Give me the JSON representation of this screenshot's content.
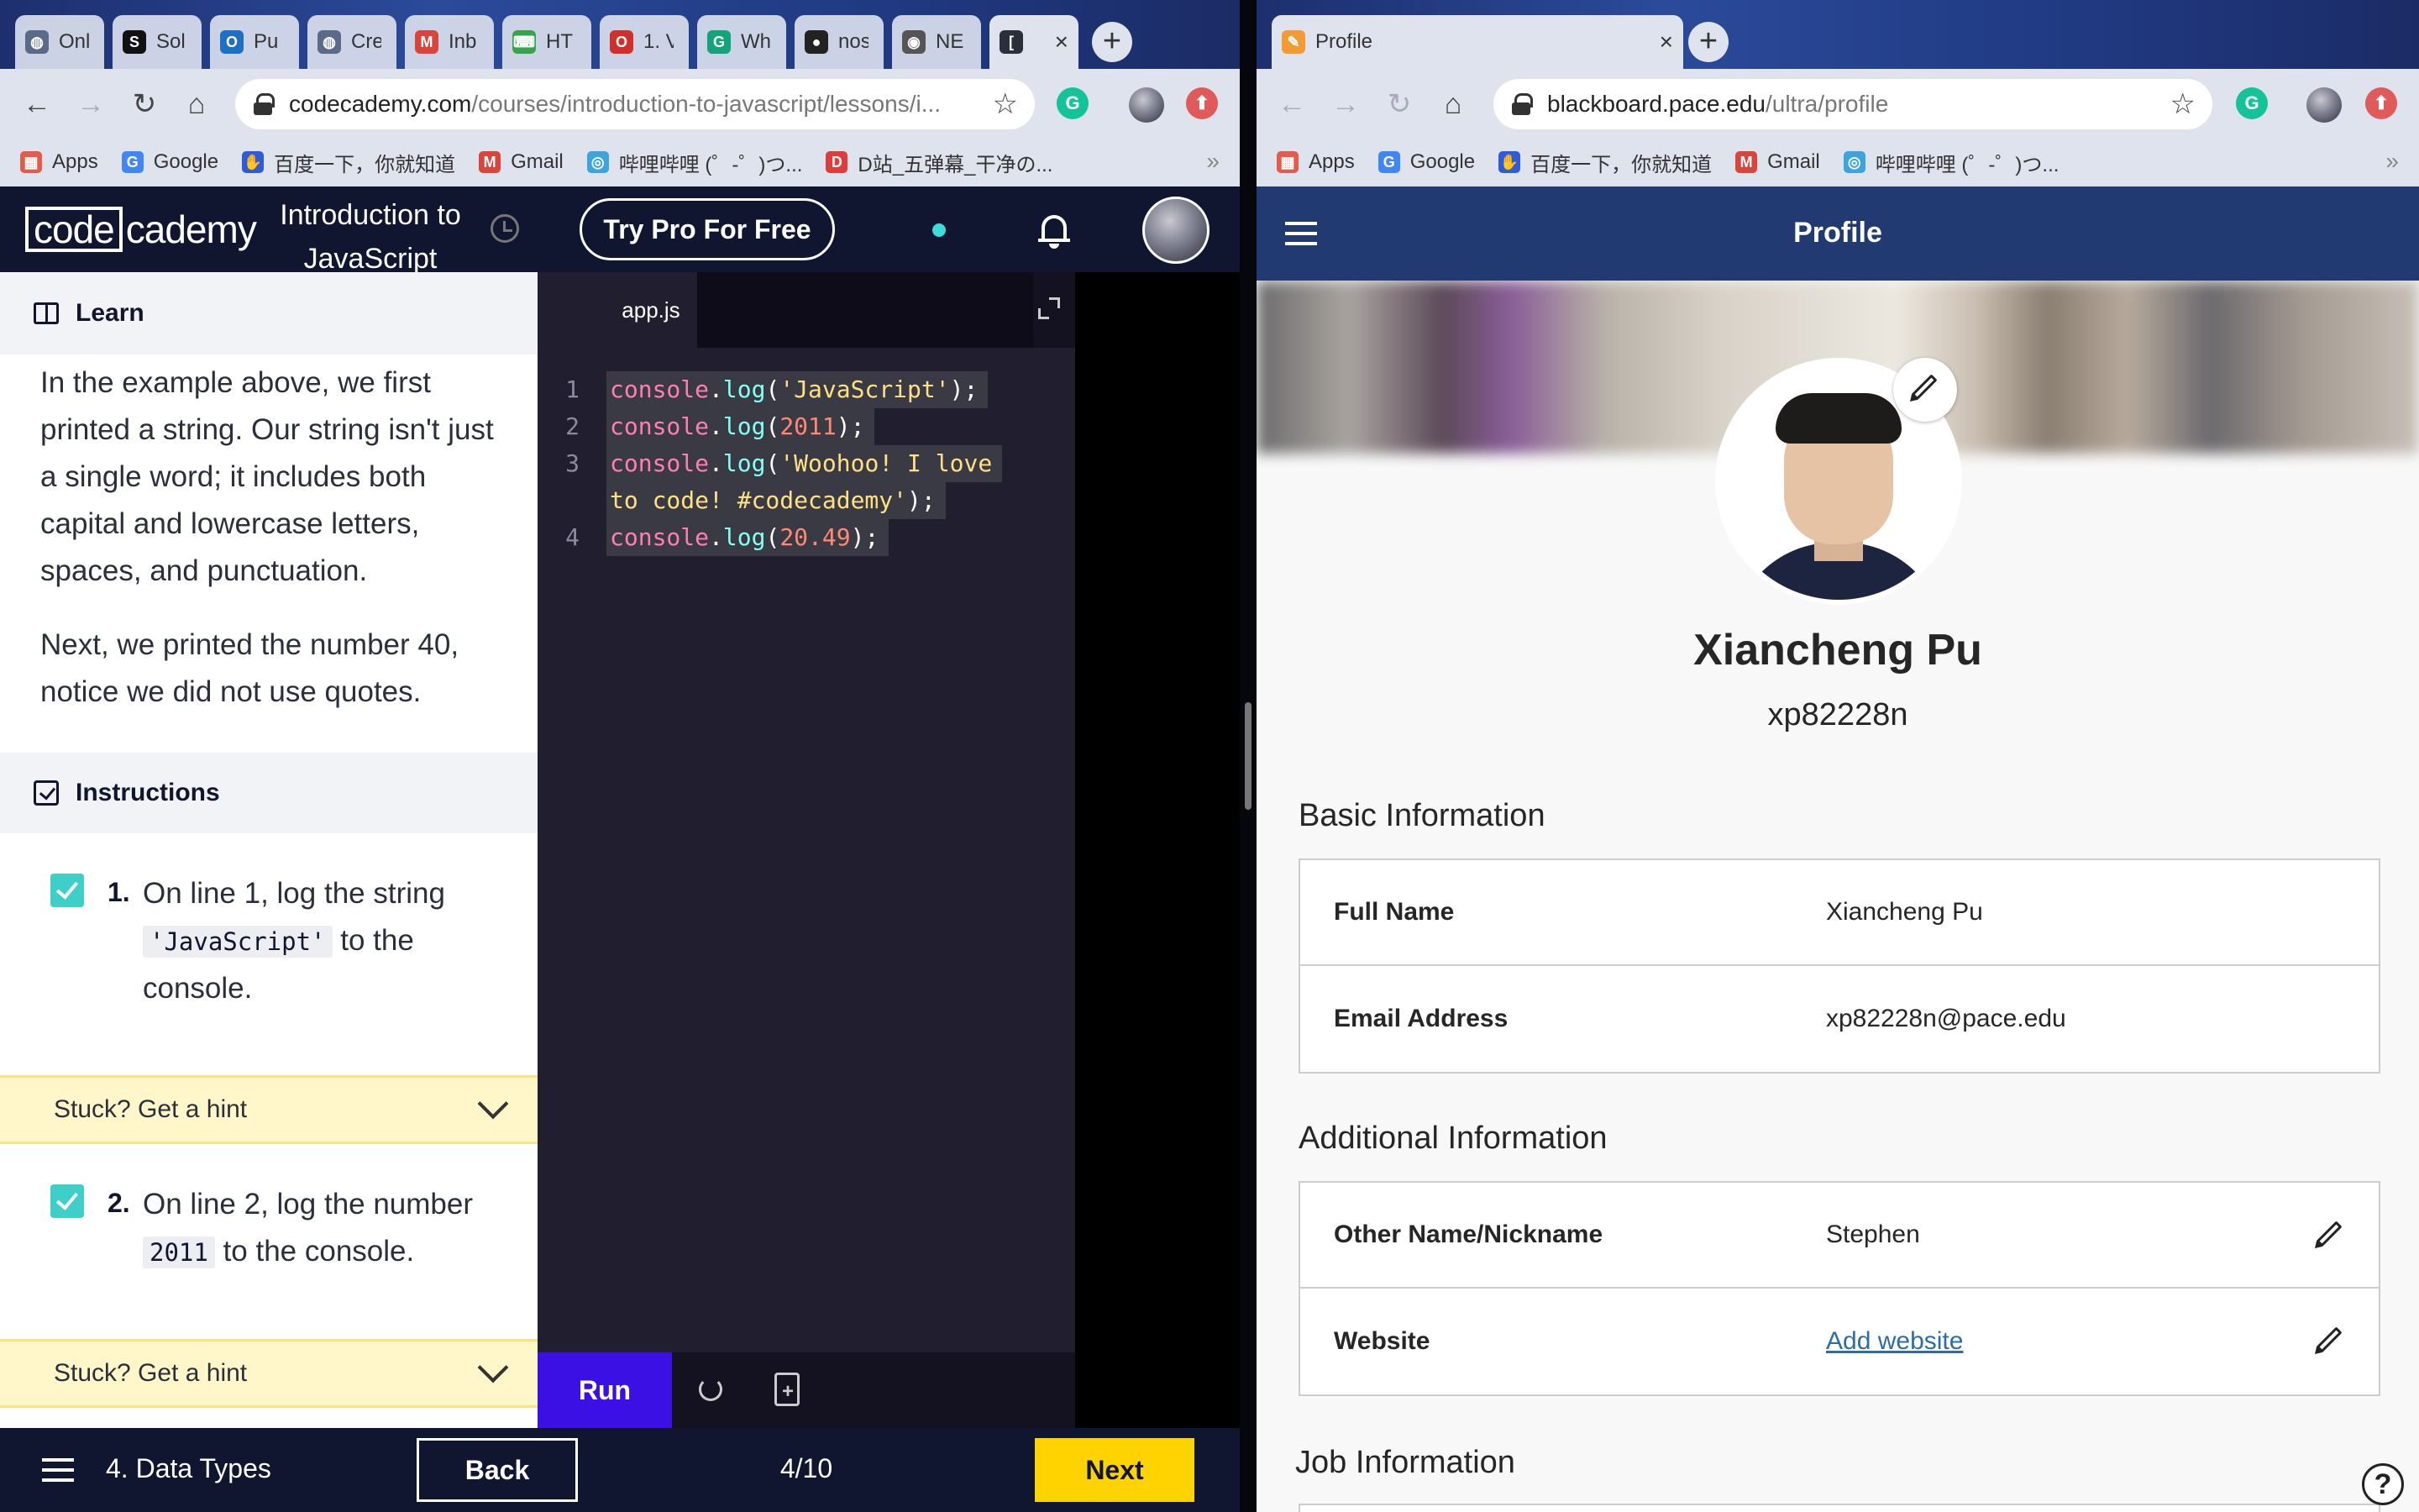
{
  "left_browser": {
    "tabs": [
      {
        "label": "Onl",
        "icon": "globe-icon",
        "color": "#5a6b8a"
      },
      {
        "label": "Sol",
        "icon": "s-logo-icon",
        "color": "#111111"
      },
      {
        "label": "Pu",
        "icon": "outlook-icon",
        "color": "#1f6fc5"
      },
      {
        "label": "Cre",
        "icon": "globe-icon",
        "color": "#5a6b8a"
      },
      {
        "label": "Inb",
        "icon": "gmail-icon",
        "color": "#d9453b"
      },
      {
        "label": "HT",
        "icon": "code-icon",
        "color": "#37a34a"
      },
      {
        "label": "1. V",
        "icon": "opera-icon",
        "color": "#d0302c"
      },
      {
        "label": "Wh",
        "icon": "grammarly-icon",
        "color": "#15a37a"
      },
      {
        "label": "nos",
        "icon": "github-icon",
        "color": "#222222"
      },
      {
        "label": "NE",
        "icon": "gamepad-icon",
        "color": "#555555"
      }
    ],
    "active_tab_icon": "codecademy-icon",
    "url_host": "codecademy.com",
    "url_path": "/courses/introduction-to-javascript/lessons/i...",
    "bookmarks": [
      "Apps",
      "Google",
      "百度一下，你就知道",
      "Gmail",
      "哔哩哔哩 (゜-゜)つ...",
      "D站_五弹幕_干净の..."
    ],
    "bookmarks_more": "»"
  },
  "codecademy": {
    "logo_box": "code",
    "logo_rest": "cademy",
    "course_title": "Introduction to JavaScript",
    "pro_button": "Try Pro For Free",
    "learn_title": "Learn",
    "learn_para1": "In the example above, we first printed a string. Our string isn't just a single word; it includes both capital and lowercase letters, spaces, and punctuation.",
    "learn_para2": "Next, we printed the number 40, notice we did not use quotes.",
    "instructions_title": "Instructions",
    "tasks": [
      {
        "num": "1.",
        "pre": "On line 1, log the string ",
        "code": "'JavaScript'",
        "post": " to the console."
      },
      {
        "num": "2.",
        "pre": "On line 2, log the number ",
        "code": "2011",
        "post": " to the console."
      }
    ],
    "hint_label": "Stuck? Get a hint",
    "editor_tab": "app.js",
    "code_lines": [
      {
        "ln": "1",
        "obj": "console",
        "fn": "log",
        "arg": "'JavaScript'",
        "arg_type": "str"
      },
      {
        "ln": "2",
        "obj": "console",
        "fn": "log",
        "arg": "2011",
        "arg_type": "num"
      },
      {
        "ln": "3",
        "obj": "console",
        "fn": "log",
        "arg": "'Woohoo! I love",
        "arg2": "to code! #codecademy'",
        "arg_type": "str"
      },
      {
        "ln": "4",
        "obj": "console",
        "fn": "log",
        "arg": "20.49",
        "arg_type": "num"
      }
    ],
    "run_label": "Run",
    "footer_lesson": "4. Data Types",
    "back_label": "Back",
    "progress": "4/10",
    "next_label": "Next"
  },
  "right_browser": {
    "tab_title": "Profile",
    "url_host": "blackboard.pace.edu",
    "url_path": "/ultra/profile",
    "bookmarks": [
      "Apps",
      "Google",
      "百度一下，你就知道",
      "Gmail",
      "哔哩哔哩 (゜-゜)つ..."
    ],
    "bookmarks_more": "»"
  },
  "blackboard": {
    "header_title": "Profile",
    "name": "Xiancheng Pu",
    "username": "xp82228n",
    "basic_title": "Basic Information",
    "basic": [
      {
        "label": "Full Name",
        "value": "Xiancheng Pu"
      },
      {
        "label": "Email Address",
        "value": "xp82228n@pace.edu"
      }
    ],
    "additional_title": "Additional Information",
    "additional": [
      {
        "label": "Other Name/Nickname",
        "value": "Stephen"
      },
      {
        "label": "Website",
        "value": "Add website"
      }
    ],
    "job_title": "Job Information",
    "help": "?"
  }
}
